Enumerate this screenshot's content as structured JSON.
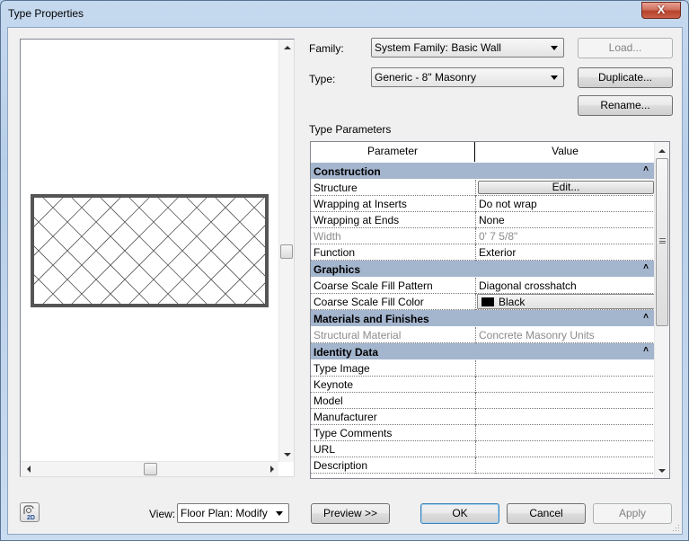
{
  "window": {
    "title": "Type Properties",
    "close_label": "X"
  },
  "family": {
    "label": "Family:",
    "value": "System Family: Basic Wall"
  },
  "type": {
    "label": "Type:",
    "value": "Generic - 8\" Masonry"
  },
  "buttons": {
    "load": "Load...",
    "duplicate": "Duplicate...",
    "rename": "Rename...",
    "preview": "Preview >>",
    "ok": "OK",
    "cancel": "Cancel",
    "apply": "Apply"
  },
  "type_parameters_label": "Type Parameters",
  "grid": {
    "headers": [
      "Parameter",
      "Value"
    ],
    "groups": [
      {
        "name": "Construction",
        "rows": [
          {
            "param": "Structure",
            "value": "Edit...",
            "kind": "button"
          },
          {
            "param": "Wrapping at Inserts",
            "value": "Do not wrap"
          },
          {
            "param": "Wrapping at Ends",
            "value": "None"
          },
          {
            "param": "Width",
            "value": "0'  7 5/8\"",
            "disabled": true
          },
          {
            "param": "Function",
            "value": "Exterior"
          }
        ]
      },
      {
        "name": "Graphics",
        "rows": [
          {
            "param": "Coarse Scale Fill Pattern",
            "value": "Diagonal crosshatch"
          },
          {
            "param": "Coarse Scale Fill Color",
            "value": "Black",
            "kind": "color",
            "color": "#000000"
          }
        ]
      },
      {
        "name": "Materials and Finishes",
        "rows": [
          {
            "param": "Structural Material",
            "value": "Concrete Masonry Units",
            "disabled": true
          }
        ]
      },
      {
        "name": "Identity Data",
        "rows": [
          {
            "param": "Type Image",
            "value": ""
          },
          {
            "param": "Keynote",
            "value": ""
          },
          {
            "param": "Model",
            "value": ""
          },
          {
            "param": "Manufacturer",
            "value": ""
          },
          {
            "param": "Type Comments",
            "value": ""
          },
          {
            "param": "URL",
            "value": ""
          },
          {
            "param": "Description",
            "value": ""
          }
        ]
      }
    ],
    "collapse_glyph": "˄"
  },
  "view": {
    "label": "View:",
    "value": "Floor Plan: Modify typ"
  },
  "icons": {
    "view_2d": "2D"
  },
  "colors": {
    "group_header": "#a4b5ce",
    "wall_outline": "#555555"
  }
}
